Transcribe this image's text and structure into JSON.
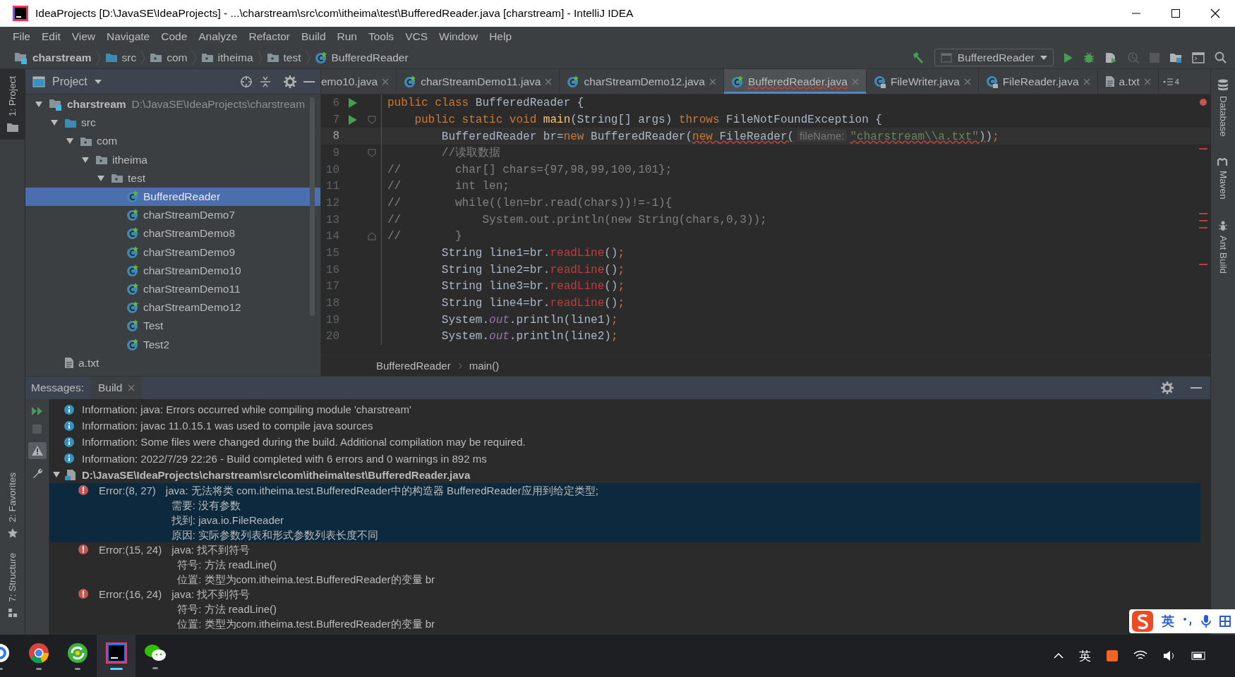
{
  "window": {
    "title": "IdeaProjects [D:\\JavaSE\\IdeaProjects] - ...\\charstream\\src\\com\\itheima\\test\\BufferedReader.java [charstream] - IntelliJ IDEA"
  },
  "menu": [
    "File",
    "Edit",
    "View",
    "Navigate",
    "Code",
    "Analyze",
    "Refactor",
    "Build",
    "Run",
    "Tools",
    "VCS",
    "Window",
    "Help"
  ],
  "navigation": {
    "crumbs": [
      {
        "label": "charstream",
        "kind": "module"
      },
      {
        "label": "src",
        "kind": "source-folder"
      },
      {
        "label": "com",
        "kind": "package"
      },
      {
        "label": "itheima",
        "kind": "package"
      },
      {
        "label": "test",
        "kind": "package"
      },
      {
        "label": "BufferedReader",
        "kind": "class"
      }
    ],
    "run_configuration": "BufferedReader"
  },
  "side_tools_left": [
    {
      "label": "1: Project",
      "kind": "folder",
      "selected": true
    },
    {
      "label": "2: Favorites",
      "kind": "star",
      "selected": false
    },
    {
      "label": "7: Structure",
      "kind": "structure",
      "selected": false
    }
  ],
  "side_tools_right": [
    {
      "label": "Database",
      "kind": "database"
    },
    {
      "label": "Maven",
      "kind": "maven"
    },
    {
      "label": "Ant Build",
      "kind": "ant"
    }
  ],
  "project": {
    "title": "Project",
    "tree": [
      {
        "label": "charstream",
        "kind": "module",
        "path": "D:\\JavaSE\\IdeaProjects\\charstream",
        "expanded": true,
        "selected": false,
        "children": [
          {
            "label": "src",
            "kind": "source-folder",
            "expanded": true,
            "selected": false,
            "children": [
              {
                "label": "com",
                "kind": "package",
                "expanded": true,
                "selected": false,
                "children": [
                  {
                    "label": "itheima",
                    "kind": "package",
                    "expanded": true,
                    "selected": false,
                    "children": [
                      {
                        "label": "test",
                        "kind": "package",
                        "expanded": true,
                        "selected": false,
                        "children": [
                          {
                            "label": "BufferedReader",
                            "kind": "class",
                            "selected": true
                          },
                          {
                            "label": "charStreamDemo7",
                            "kind": "class",
                            "selected": false
                          },
                          {
                            "label": "charStreamDemo8",
                            "kind": "class",
                            "selected": false
                          },
                          {
                            "label": "charStreamDemo9",
                            "kind": "class",
                            "selected": false
                          },
                          {
                            "label": "charStreamDemo10",
                            "kind": "class",
                            "selected": false
                          },
                          {
                            "label": "charStreamDemo11",
                            "kind": "class",
                            "selected": false
                          },
                          {
                            "label": "charStreamDemo12",
                            "kind": "class",
                            "selected": false
                          },
                          {
                            "label": "Test",
                            "kind": "class",
                            "selected": false
                          },
                          {
                            "label": "Test2",
                            "kind": "class",
                            "selected": false
                          }
                        ]
                      }
                    ]
                  }
                ]
              }
            ]
          },
          {
            "label": "a.txt",
            "kind": "text",
            "selected": false
          }
        ]
      }
    ]
  },
  "editor": {
    "tabs": [
      {
        "label": "emo10.java",
        "selected": false
      },
      {
        "label": "charStreamDemo11.java",
        "kind": "class",
        "selected": false
      },
      {
        "label": "charStreamDemo12.java",
        "kind": "class",
        "selected": false
      },
      {
        "label": "BufferedReader.java",
        "kind": "class",
        "selected": true
      },
      {
        "label": "FileWriter.java",
        "kind": "library-class",
        "selected": false
      },
      {
        "label": "FileReader.java",
        "kind": "library-class",
        "selected": false
      },
      {
        "label": "a.txt",
        "kind": "text",
        "selected": false
      }
    ],
    "hidden_tab_count": "4",
    "lines": [
      {
        "number": "6",
        "run": true,
        "current": false,
        "segments": [
          {
            "kind": "keyword",
            "text": "public class "
          },
          {
            "kind": "plain",
            "text": "BufferedReader {"
          }
        ]
      },
      {
        "number": "7",
        "run": true,
        "fold_start": true,
        "current": false,
        "segments": [
          {
            "kind": "keyword",
            "text": "    public static void "
          },
          {
            "kind": "method",
            "text": "main"
          },
          {
            "kind": "plain",
            "text": "(String[] args) "
          },
          {
            "kind": "keyword",
            "text": "throws "
          },
          {
            "kind": "plain",
            "text": "FileNotFoundException {"
          }
        ]
      },
      {
        "number": "8",
        "current": true,
        "segments": [
          {
            "kind": "plain",
            "text": "        BufferedReader br="
          },
          {
            "kind": "keyword",
            "text": "new "
          },
          {
            "kind": "plain",
            "text": "BufferedReader("
          },
          {
            "kind": "keyword",
            "text": "new ",
            "squiggle": true
          },
          {
            "kind": "plain",
            "text": "FileReader(",
            "squiggle": true
          },
          {
            "kind": "hint",
            "text": "fileName:"
          },
          {
            "kind": "string",
            "text": "\"charstream\\\\a.txt\"",
            "squiggle": true
          },
          {
            "kind": "plain",
            "text": ")",
            "squiggle": true
          },
          {
            "kind": "plain",
            "text": ")"
          },
          {
            "kind": "keyword",
            "text": ";"
          }
        ]
      },
      {
        "number": "9",
        "fold_start": true,
        "current": false,
        "segments": [
          {
            "kind": "comment",
            "text": "        //读取数据"
          }
        ]
      },
      {
        "number": "10",
        "current": false,
        "segments": [
          {
            "kind": "comment",
            "text": "//        char[] chars={97,98,99,100,101};"
          }
        ]
      },
      {
        "number": "11",
        "current": false,
        "segments": [
          {
            "kind": "comment",
            "text": "//        int len;"
          }
        ]
      },
      {
        "number": "12",
        "current": false,
        "segments": [
          {
            "kind": "comment",
            "text": "//        while((len=br.read(chars))!=-1){"
          }
        ]
      },
      {
        "number": "13",
        "current": false,
        "segments": [
          {
            "kind": "comment",
            "text": "//            System.out.println(new String(chars,0,3));"
          }
        ]
      },
      {
        "number": "14",
        "fold_end": true,
        "current": false,
        "segments": [
          {
            "kind": "comment",
            "text": "//        }"
          }
        ]
      },
      {
        "number": "15",
        "current": false,
        "segments": [
          {
            "kind": "plain",
            "text": "        String line1=br."
          },
          {
            "kind": "error",
            "text": "readLine"
          },
          {
            "kind": "plain",
            "text": "()"
          },
          {
            "kind": "keyword",
            "text": ";"
          }
        ]
      },
      {
        "number": "16",
        "current": false,
        "segments": [
          {
            "kind": "plain",
            "text": "        String line2=br."
          },
          {
            "kind": "error",
            "text": "readLine"
          },
          {
            "kind": "plain",
            "text": "()"
          },
          {
            "kind": "keyword",
            "text": ";"
          }
        ]
      },
      {
        "number": "17",
        "current": false,
        "segments": [
          {
            "kind": "plain",
            "text": "        String line3=br."
          },
          {
            "kind": "error",
            "text": "readLine"
          },
          {
            "kind": "plain",
            "text": "()"
          },
          {
            "kind": "keyword",
            "text": ";"
          }
        ]
      },
      {
        "number": "18",
        "current": false,
        "segments": [
          {
            "kind": "plain",
            "text": "        String line4=br."
          },
          {
            "kind": "error",
            "text": "readLine"
          },
          {
            "kind": "plain",
            "text": "()"
          },
          {
            "kind": "keyword",
            "text": ";"
          }
        ]
      },
      {
        "number": "19",
        "current": false,
        "segments": [
          {
            "kind": "plain",
            "text": "        System."
          },
          {
            "kind": "field",
            "text": "out"
          },
          {
            "kind": "plain",
            "text": ".println(line1)"
          },
          {
            "kind": "keyword",
            "text": ";"
          }
        ]
      },
      {
        "number": "20",
        "current": false,
        "segments": [
          {
            "kind": "plain",
            "text": "        System."
          },
          {
            "kind": "field",
            "text": "out"
          },
          {
            "kind": "plain",
            "text": ".println(line2)"
          },
          {
            "kind": "keyword",
            "text": ";"
          }
        ]
      }
    ],
    "breadcrumb": [
      "BufferedReader",
      "main()"
    ]
  },
  "messages": {
    "title": "Messages:",
    "tabs": [
      {
        "label": "Build",
        "selected": true
      }
    ],
    "items": [
      {
        "kind": "info",
        "text": "Information: java: Errors occurred while compiling module 'charstream'"
      },
      {
        "kind": "info",
        "text": "Information: javac 11.0.15.1 was used to compile java sources"
      },
      {
        "kind": "info",
        "text": "Information: Some files were changed during the build. Additional compilation may be required."
      },
      {
        "kind": "info",
        "text": "Information: 2022/7/29 22:26 - Build completed with 6 errors and 0 warnings in 892 ms"
      },
      {
        "kind": "file",
        "text": "D:\\JavaSE\\IdeaProjects\\charstream\\src\\com\\itheima\\test\\BufferedReader.java",
        "expanded": true
      },
      {
        "kind": "error",
        "position": "Error:(8, 27)",
        "text": "java: 无法将类 com.itheima.test.BufferedReader中的构造器 BufferedReader应用到给定类型;",
        "details": [
          "需要: 没有参数",
          "找到: java.io.FileReader",
          "原因: 实际参数列表和形式参数列表长度不同"
        ],
        "selected": true
      },
      {
        "kind": "error",
        "position": "Error:(15, 24)",
        "text": "java: 找不到符号",
        "details": [
          "符号:   方法 readLine()",
          "位置: 类型为com.itheima.test.BufferedReader的变量 br"
        ],
        "selected": false
      },
      {
        "kind": "error",
        "position": "Error:(16, 24)",
        "text": "java: 找不到符号",
        "details": [
          "符号:   方法 readLine()",
          "位置: 类型为com.itheima.test.BufferedReader的变量 br"
        ],
        "selected": false
      }
    ]
  },
  "taskbar": {
    "apps": [
      {
        "kind": "cloud",
        "selected": false
      },
      {
        "kind": "browser",
        "selected": false
      },
      {
        "kind": "swirl",
        "selected": false
      },
      {
        "kind": "ide",
        "selected": true
      },
      {
        "kind": "chat",
        "selected": false
      }
    ],
    "language": "英"
  },
  "ime_toolbar": {
    "language": "英"
  }
}
